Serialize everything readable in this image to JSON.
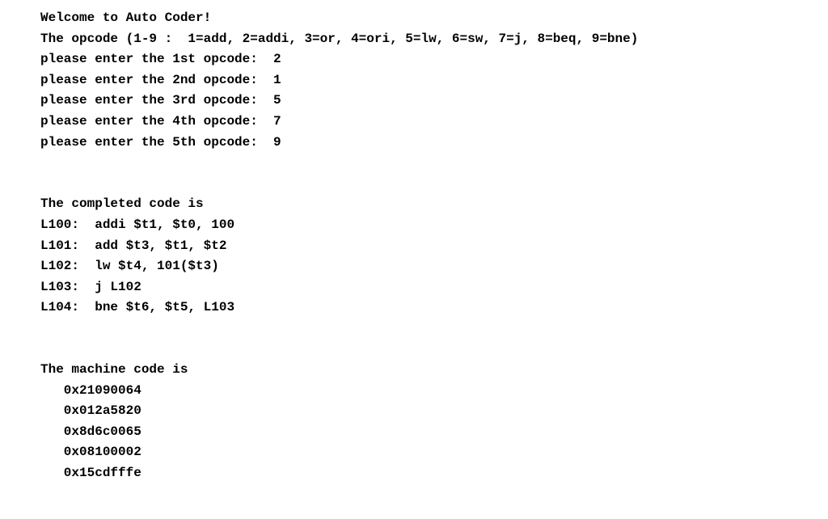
{
  "welcome": "Welcome to Auto Coder!",
  "opcode_legend": "The opcode (1-9 :  1=add, 2=addi, 3=or, 4=ori, 5=lw, 6=sw, 7=j, 8=beq, 9=bne)",
  "prompts": [
    {
      "label": "please enter the 1st opcode:  ",
      "value": "2"
    },
    {
      "label": "please enter the 2nd opcode:  ",
      "value": "1"
    },
    {
      "label": "please enter the 3rd opcode:  ",
      "value": "5"
    },
    {
      "label": "please enter the 4th opcode:  ",
      "value": "7"
    },
    {
      "label": "please enter the 5th opcode:  ",
      "value": "9"
    }
  ],
  "completed_header": "The completed code is",
  "completed_code": [
    "L100:  addi $t1, $t0, 100",
    "L101:  add $t3, $t1, $t2",
    "L102:  lw $t4, 101($t3)",
    "L103:  j L102",
    "L104:  bne $t6, $t5, L103"
  ],
  "machine_header": "The machine code is",
  "machine_code": [
    "   0x21090064",
    "   0x012a5820",
    "   0x8d6c0065",
    "   0x08100002",
    "   0x15cdfffe"
  ]
}
